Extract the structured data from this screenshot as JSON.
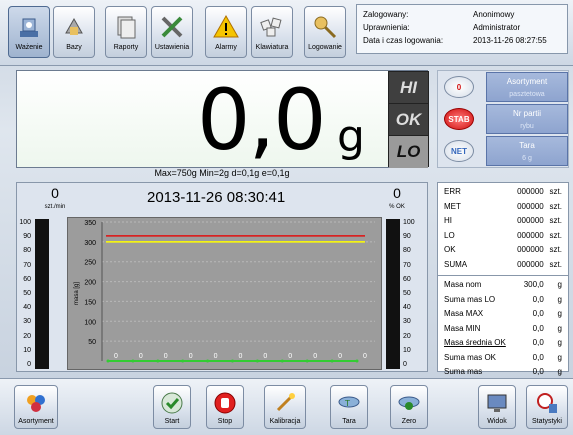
{
  "toolbar": {
    "items": [
      {
        "label": "Ważenie",
        "icon": "scale-icon"
      },
      {
        "label": "Bazy",
        "icon": "database-icon"
      },
      {
        "label": "Raporty",
        "icon": "reports-icon"
      },
      {
        "label": "Ustawienia",
        "icon": "settings-tools-icon"
      },
      {
        "label": "Alarmy",
        "icon": "warning-icon"
      },
      {
        "label": "Klawiatura",
        "icon": "keyboard-icon"
      },
      {
        "label": "Logowanie",
        "icon": "login-key-icon"
      }
    ],
    "active_index": 0
  },
  "login": {
    "rows": [
      {
        "key": "Zalogowany:",
        "value": "Anonimowy"
      },
      {
        "key": "Uprawnienia:",
        "value": "Administrator"
      },
      {
        "key": "Data i czas logowania:",
        "value": "2013-11-26 08:27:55"
      }
    ]
  },
  "display": {
    "weight": "0,0",
    "unit": "g",
    "params": "Max=750g Min=2g d=0,1g e=0,1g",
    "indicators": [
      {
        "label": "HI",
        "active": false
      },
      {
        "label": "OK",
        "active": false
      },
      {
        "label": "LO",
        "active": true
      }
    ]
  },
  "side": {
    "badges": [
      "0",
      "STAB",
      "NET"
    ],
    "boxes": [
      {
        "title": "Asortyment",
        "value": "pasztetowa"
      },
      {
        "title": "Nr partii",
        "value": "rybu"
      },
      {
        "title": "Tara",
        "value": "6 g"
      }
    ]
  },
  "graph": {
    "left_value": "0",
    "left_unit": "szt./min",
    "datetime": "2013-11-26 08:30:41",
    "right_value": "0",
    "right_unit": "% OK",
    "scale_labels": [
      "100",
      "90",
      "80",
      "70",
      "60",
      "50",
      "40",
      "30",
      "20",
      "10",
      "0"
    ],
    "y_axis_label": "masa [g]"
  },
  "chart_data": {
    "type": "line",
    "ylabel": "masa [g]",
    "ylim": [
      0,
      350
    ],
    "yticks": [
      50,
      100,
      150,
      200,
      250,
      300,
      350
    ],
    "x": [
      1,
      2,
      3,
      4,
      5,
      6,
      7,
      8,
      9,
      10,
      11
    ],
    "point_labels": [
      "0",
      "0",
      "0",
      "0",
      "0",
      "0",
      "0",
      "0",
      "0",
      "0",
      "0"
    ],
    "series": [
      {
        "values": [
          0,
          0,
          0,
          0,
          0,
          0,
          0,
          0,
          0,
          0,
          0
        ],
        "color": "#33cc33"
      }
    ],
    "thresholds": [
      {
        "value": 315,
        "color": "#e01010"
      },
      {
        "value": 300,
        "color": "#ffff00"
      }
    ]
  },
  "counters": {
    "group1": [
      {
        "label": "ERR",
        "value": "000000",
        "unit": "szt."
      },
      {
        "label": "MET",
        "value": "000000",
        "unit": "szt."
      },
      {
        "label": "HI",
        "value": "000000",
        "unit": "szt."
      },
      {
        "label": "LO",
        "value": "000000",
        "unit": "szt."
      },
      {
        "label": "OK",
        "value": "000000",
        "unit": "szt."
      },
      {
        "label": "SUMA",
        "value": "000000",
        "unit": "szt."
      }
    ],
    "group2": [
      {
        "label": "Masa nom",
        "value": "300,0",
        "unit": "g",
        "underline": false
      },
      {
        "label": "Suma mas LO",
        "value": "0,0",
        "unit": "g",
        "underline": false
      },
      {
        "label": "Masa MAX",
        "value": "0,0",
        "unit": "g",
        "underline": false
      },
      {
        "label": "Masa MIN",
        "value": "0,0",
        "unit": "g",
        "underline": false
      },
      {
        "label": "Masa średnia OK",
        "value": "0,0",
        "unit": "g",
        "underline": true
      },
      {
        "label": "Suma mas OK",
        "value": "0,0",
        "unit": "g",
        "underline": false
      },
      {
        "label": "Suma mas",
        "value": "0,0",
        "unit": "g",
        "underline": false
      }
    ]
  },
  "bottom": {
    "items": [
      {
        "label": "Asortyment",
        "icon": "products-icon"
      },
      {
        "label": "Start",
        "icon": "start-check-icon"
      },
      {
        "label": "Stop",
        "icon": "stop-hand-icon"
      },
      {
        "label": "Kalibracja",
        "icon": "calibration-wand-icon"
      },
      {
        "label": "Tara",
        "icon": "tare-icon"
      },
      {
        "label": "Zero",
        "icon": "zero-icon"
      },
      {
        "label": "Widok",
        "icon": "view-monitor-icon"
      },
      {
        "label": "Statystyki",
        "icon": "statistics-icon"
      }
    ]
  },
  "colors": {
    "accent": "#8ea4cf",
    "badge_red": "#d01010",
    "badge_text": "#3366bb"
  }
}
